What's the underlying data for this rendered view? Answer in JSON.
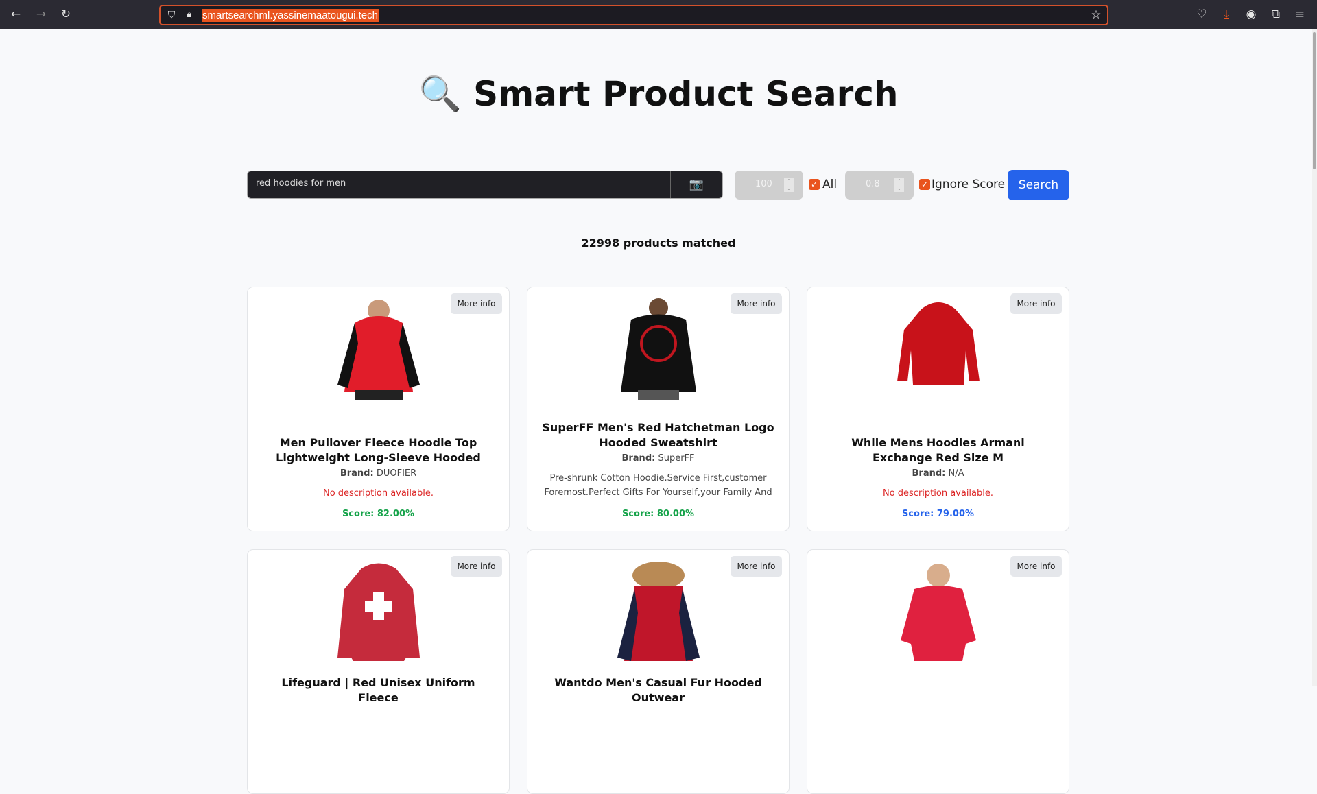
{
  "browser": {
    "url": "smartsearchml.yassinemaatougui.tech"
  },
  "page": {
    "title": "🔍 Smart Product Search"
  },
  "search": {
    "query": "red hoodies for men",
    "camera_icon": "📷",
    "count_value": "100",
    "all_label": "All",
    "threshold_value": "0.8",
    "ignore_score_label": "Ignore Score",
    "search_label": "Search"
  },
  "results": {
    "matched": "22998 products matched"
  },
  "colors": {
    "score_green": "#16a34a",
    "score_blue": "#2563eb",
    "accent": "#2563eb"
  },
  "products": [
    {
      "more": "More info",
      "title": "Men Pullover Fleece Hoodie Top Lightweight Long-Sleeve Hooded",
      "brand_label": "Brand:",
      "brand": "DUOFIER",
      "description": "No description available.",
      "score": "Score: 82.00%"
    },
    {
      "more": "More info",
      "title": "SuperFF Men's Red Hatchetman Logo Hooded Sweatshirt",
      "brand_label": "Brand:",
      "brand": "SuperFF",
      "description": "Pre-shrunk Cotton Hoodie.Service First,customer Foremost.Perfect Gifts For Yourself,your Family And",
      "score": "Score: 80.00%"
    },
    {
      "more": "More info",
      "title": "While Mens Hoodies Armani Exchange Red Size M",
      "brand_label": "Brand:",
      "brand": "N/A",
      "description": "No description available.",
      "score": "Score: 79.00%"
    },
    {
      "more": "More info",
      "title": "Lifeguard | Red Unisex Uniform Fleece"
    },
    {
      "more": "More info",
      "title": "Wantdo Men's Casual Fur Hooded Outwear"
    },
    {
      "more": "More info",
      "title": ""
    }
  ]
}
